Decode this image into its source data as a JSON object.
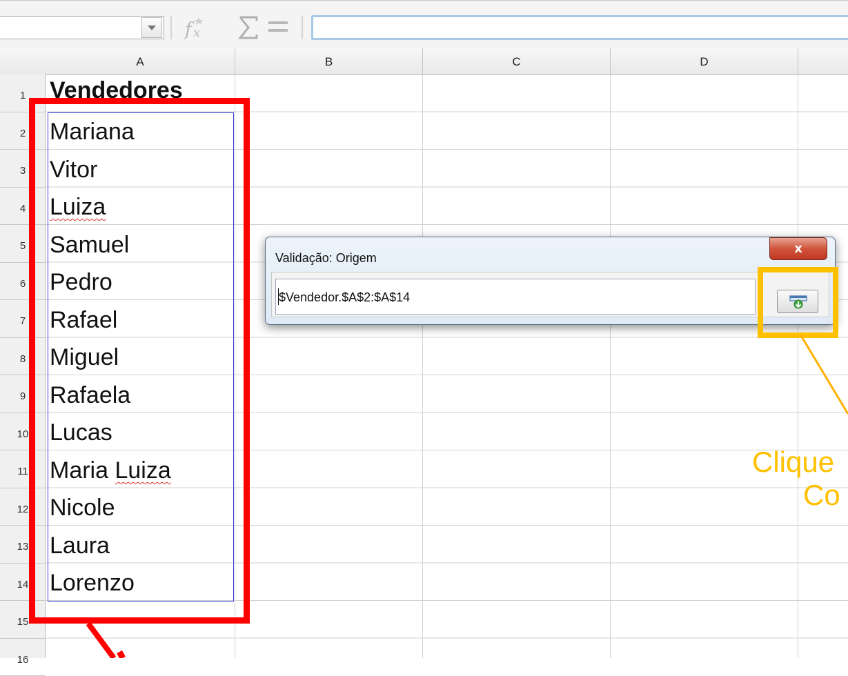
{
  "formula_bar": {
    "name_box_value": "",
    "formula_value": "",
    "icons": [
      "chevron-down-icon",
      "function-wizard-icon",
      "sum-icon",
      "equals-icon"
    ]
  },
  "columns": [
    "A",
    "B",
    "C",
    "D"
  ],
  "rows": [
    "1",
    "2",
    "3",
    "4",
    "5",
    "6",
    "7",
    "8",
    "9",
    "10",
    "11",
    "12",
    "13",
    "14",
    "15",
    "16"
  ],
  "cells": {
    "A1": "Vendedores",
    "A2": "Mariana",
    "A3": "Vitor",
    "A4": "Luiza",
    "A5": "Samuel",
    "A6": "Pedro",
    "A7": "Rafael",
    "A8": "Miguel",
    "A9": "Rafaela",
    "A10": "Lucas",
    "A11_first": "Maria",
    "A11_second": "Luiza",
    "A12": "Nicole",
    "A13": "Laura",
    "A14": "Lorenzo"
  },
  "dialog": {
    "title": "Validação: Origem",
    "close_label": "x",
    "range_value": "$Vendedor.$A$2:$A$14"
  },
  "annotation": {
    "line1": "Clique",
    "line2": "Co",
    "color": "#ffc000"
  },
  "highlight": {
    "red": "#ff0000",
    "blue": "#3a3adc",
    "yellow": "#ffc000"
  }
}
